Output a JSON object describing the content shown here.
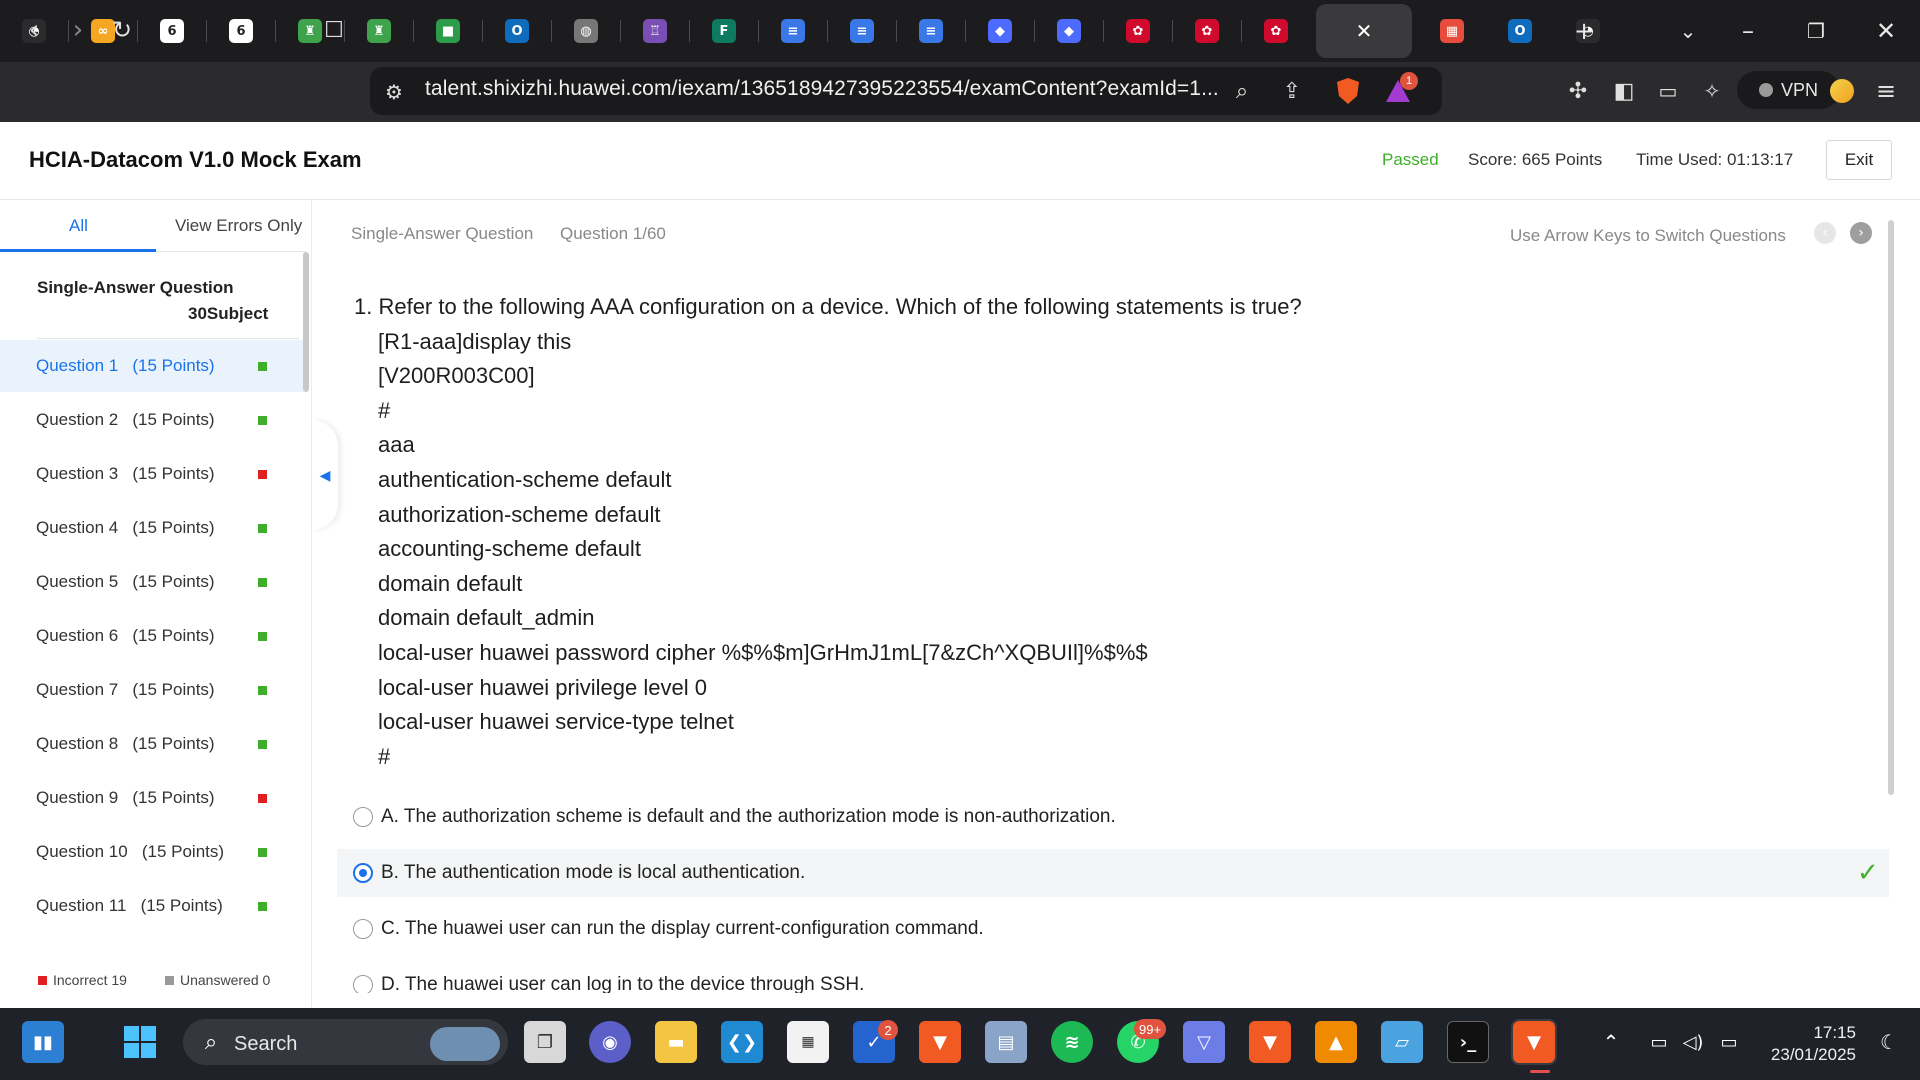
{
  "browser": {
    "url": "talent.shixizhi.huawei.com/iexam/1365189427395223554/examContent?examId=1...",
    "vpn_label": "VPN",
    "notification_count": "1",
    "tabs": [
      {
        "icon": "gauge-icon",
        "color": "#2b2b2d"
      },
      {
        "icon": "copilot-icon",
        "color": "#f5a623"
      },
      {
        "icon": "app-6-icon",
        "color": "#ffffff"
      },
      {
        "icon": "app-6-icon",
        "color": "#ffffff"
      },
      {
        "icon": "ai-bot-icon",
        "color": "#3fa34d"
      },
      {
        "icon": "ai-bot-icon",
        "color": "#3fa34d"
      },
      {
        "icon": "meet-icon",
        "color": "#2c9c4b"
      },
      {
        "icon": "outlook-icon",
        "color": "#0f6cbd"
      },
      {
        "icon": "globe-icon",
        "color": "#777777"
      },
      {
        "icon": "castle-icon",
        "color": "#7a4fb5"
      },
      {
        "icon": "forms-icon",
        "color": "#0e7a5f"
      },
      {
        "icon": "docs-icon",
        "color": "#3b78e7"
      },
      {
        "icon": "docs-icon",
        "color": "#3b78e7"
      },
      {
        "icon": "docs-icon",
        "color": "#3b78e7"
      },
      {
        "icon": "deepseek-icon",
        "color": "#4d6bfe"
      },
      {
        "icon": "deepseek-icon",
        "color": "#4d6bfe"
      },
      {
        "icon": "huawei-icon",
        "color": "#cf0a2c"
      },
      {
        "icon": "huawei-icon",
        "color": "#cf0a2c"
      },
      {
        "icon": "huawei-icon",
        "color": "#cf0a2c"
      }
    ]
  },
  "exam": {
    "title": "HCIA-Datacom V1.0 Mock Exam",
    "status": "Passed",
    "score": "Score:  665 Points",
    "time_used": "Time Used:  01:13:17",
    "exit_label": "Exit"
  },
  "sidebar": {
    "tab_all": "All",
    "tab_errors": "View Errors Only",
    "section_title": "Single-Answer Question",
    "section_sub": "30Subject",
    "questions": [
      {
        "label": "Question 1   (15 Points)",
        "status": "correct",
        "active": true
      },
      {
        "label": "Question 2   (15 Points)",
        "status": "correct"
      },
      {
        "label": "Question 3   (15 Points)",
        "status": "incorrect"
      },
      {
        "label": "Question 4   (15 Points)",
        "status": "correct"
      },
      {
        "label": "Question 5   (15 Points)",
        "status": "correct"
      },
      {
        "label": "Question 6   (15 Points)",
        "status": "correct"
      },
      {
        "label": "Question 7   (15 Points)",
        "status": "correct"
      },
      {
        "label": "Question 8   (15 Points)",
        "status": "correct"
      },
      {
        "label": "Question 9   (15 Points)",
        "status": "incorrect"
      },
      {
        "label": "Question 10   (15 Points)",
        "status": "correct"
      },
      {
        "label": "Question 11   (15 Points)",
        "status": "correct"
      }
    ],
    "legend_incorrect": "Incorrect 19",
    "legend_unanswered": "Unanswered 0"
  },
  "question": {
    "type": "Single-Answer Question",
    "number": "Question 1/60",
    "hint": "Use Arrow Keys to Switch Questions",
    "stem_first": "1. Refer to the following AAA configuration on a device. Which of the following statements is true?",
    "code_lines": [
      "[R1-aaa]display this",
      "[V200R003C00]",
      "#",
      "aaa",
      "authentication-scheme default",
      "authorization-scheme default",
      "accounting-scheme default",
      "domain default",
      "domain default_admin",
      "local-user huawei password cipher %$%$m]GrHmJ1mL[7&zCh^XQBUIl]%$%$",
      "local-user huawei privilege level 0",
      "local-user huawei service-type telnet",
      "#"
    ],
    "options": [
      {
        "text": "A. The authorization scheme is default and the authorization mode is non-authorization.",
        "selected": false
      },
      {
        "text": "B. The authentication mode is local authentication.",
        "selected": true,
        "correct": true
      },
      {
        "text": "C. The huawei user can run the display current-configuration command.",
        "selected": false
      },
      {
        "text": "D. The huawei user can log in to the device through SSH.",
        "selected": false
      }
    ]
  },
  "taskbar": {
    "search_label": "Search",
    "todo_badge": "2",
    "whatsapp_badge": "99+",
    "time": "17:15",
    "date": "23/01/2025"
  },
  "colors": {
    "accent": "#1a73e8",
    "correct": "#3fae2a",
    "incorrect": "#e02020",
    "unanswered": "#999999"
  }
}
